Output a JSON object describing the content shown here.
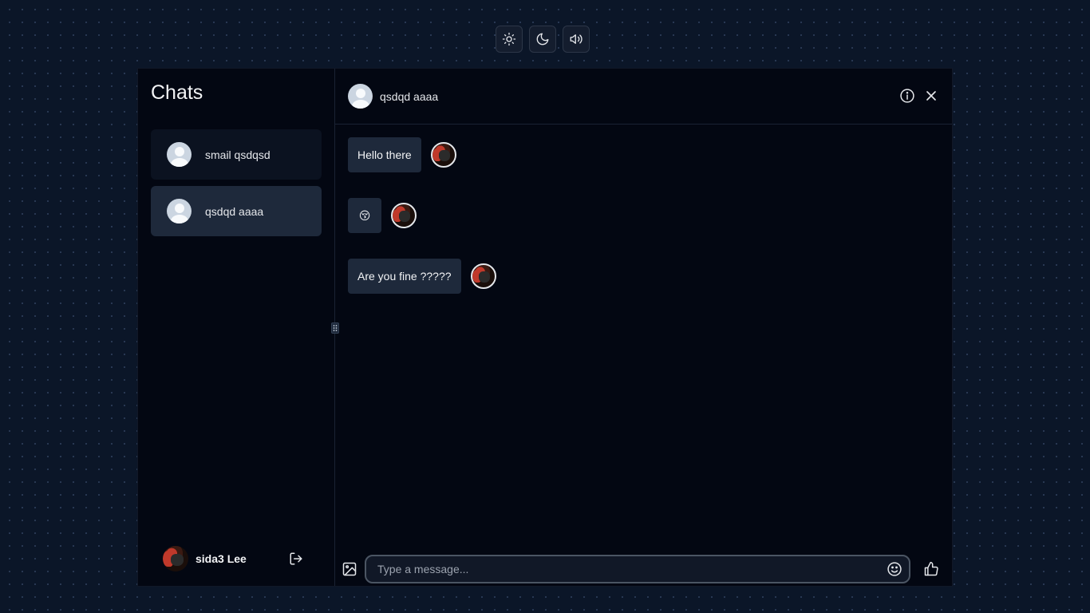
{
  "toolbar": {
    "buttons": [
      {
        "icon": "sun-icon",
        "name": "light-mode"
      },
      {
        "icon": "moon-icon",
        "name": "dark-mode"
      },
      {
        "icon": "speaker-icon",
        "name": "sound"
      }
    ]
  },
  "sidebar": {
    "title": "Chats",
    "chats": [
      {
        "name": "smail qsdqsd",
        "active": false
      },
      {
        "name": "qsdqd aaaa",
        "active": true
      }
    ],
    "user": {
      "name": "sida3 Lee"
    }
  },
  "chat": {
    "header_name": "qsdqd aaaa",
    "messages": [
      {
        "text": "Hello there",
        "type": "text"
      },
      {
        "text": "😚",
        "type": "emoji"
      },
      {
        "text": "Are you fine ?????",
        "type": "text"
      }
    ],
    "composer": {
      "placeholder": "Type a message..."
    }
  },
  "colors": {
    "background": "#0b1628",
    "panel": "#030712",
    "bubble": "#1e293b",
    "active_item": "#1e293b"
  }
}
